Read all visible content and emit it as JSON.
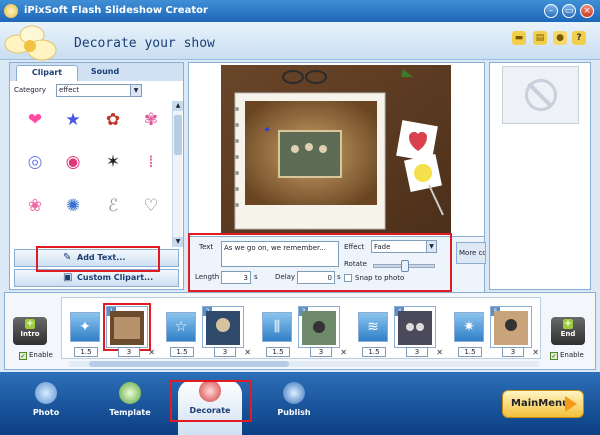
{
  "window": {
    "title": "iPixSoft Flash Slideshow Creator"
  },
  "header": {
    "title": "Decorate your show"
  },
  "left_panel": {
    "tabs": [
      {
        "label": "Clipart",
        "active": true
      },
      {
        "label": "Sound",
        "active": false
      }
    ],
    "category_label": "Category",
    "category_value": "effect",
    "add_text_label": "Add Text...",
    "custom_clipart_label": "Custom Clipart..."
  },
  "properties": {
    "text_label": "Text",
    "text_value": "As we go on, we remember...",
    "effect_label": "Effect",
    "effect_value": "Fade",
    "rotate_label": "Rotate",
    "length_label": "Length",
    "length_value": "3",
    "length_unit": "s",
    "delay_label": "Delay",
    "delay_value": "0",
    "delay_unit": "s",
    "snap_label": "Snap to photo",
    "more_label": "More cc"
  },
  "timeline": {
    "intro_label": "Intro",
    "end_label": "End",
    "enable_label": "Enable",
    "slides": [
      {
        "num": "1",
        "duration": "3"
      },
      {
        "num": "2",
        "duration": "3"
      },
      {
        "num": "3",
        "duration": "3"
      },
      {
        "num": "4",
        "duration": "3"
      },
      {
        "num": "5",
        "duration": "3"
      }
    ],
    "transitions": [
      "1.5",
      "1.5",
      "1.5",
      "1.5",
      "1.5"
    ]
  },
  "nav": {
    "items": [
      {
        "label": "Photo"
      },
      {
        "label": "Template"
      },
      {
        "label": "Decorate"
      },
      {
        "label": "Publish"
      }
    ],
    "main_menu_label": "MainMenu"
  }
}
